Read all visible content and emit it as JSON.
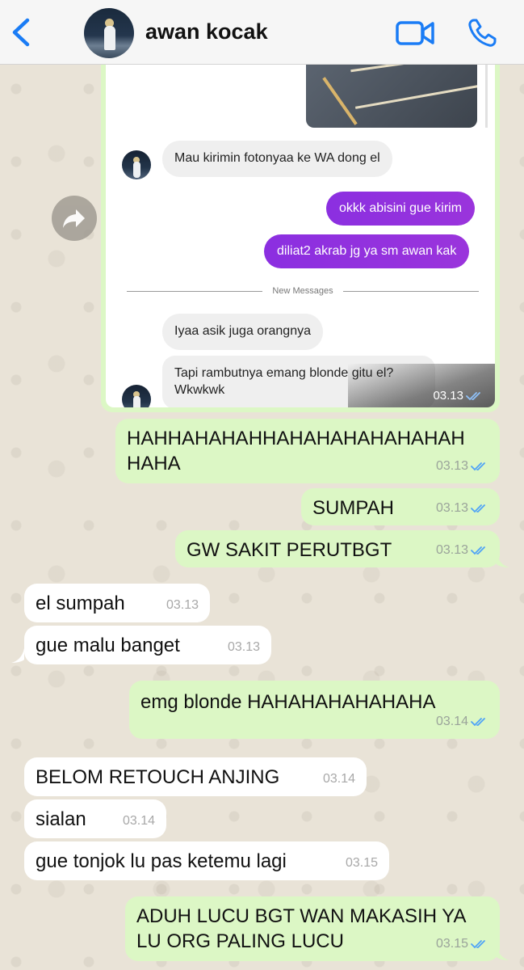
{
  "header": {
    "contact_name": "awan kocak",
    "back_icon": "chevron-left-icon",
    "video_icon": "video-camera-icon",
    "phone_icon": "phone-icon"
  },
  "screenshot": {
    "messages_in": [
      "Mau kirimin fotonyaa ke WA dong el",
      "Iyaa asik juga orangnya",
      "Tapi rambutnya emang blonde gitu el? Wkwkwk"
    ],
    "messages_out": [
      "okkk abisini gue kirim",
      "diliat2 akrab jg ya sm awan kak"
    ],
    "divider_label": "New Messages",
    "time": "03.13"
  },
  "chat": [
    {
      "dir": "out",
      "text_lines": [
        "HAHHAHAHAHHAHAHAHAHAHAHAH",
        "HAHA"
      ],
      "time": "03.13"
    },
    {
      "dir": "out",
      "text": "SUMPAH",
      "time": "03.13"
    },
    {
      "dir": "out",
      "text": "GW SAKIT PERUTBGT",
      "time": "03.13"
    },
    {
      "dir": "in",
      "text": "el sumpah",
      "time": "03.13"
    },
    {
      "dir": "in",
      "text": "gue malu banget",
      "time": "03.13"
    },
    {
      "dir": "out",
      "text": "emg blonde HAHAHAHAHAHAHA",
      "time": "03.14"
    },
    {
      "dir": "in",
      "text": "BELOM RETOUCH ANJING",
      "time": "03.14"
    },
    {
      "dir": "in",
      "text": "sialan",
      "time": "03.14"
    },
    {
      "dir": "in",
      "text": "gue tonjok lu pas ketemu lagi",
      "time": "03.15"
    },
    {
      "dir": "out",
      "text_lines": [
        "ADUH LUCU BGT WAN MAKASIH YA",
        "LU ORG PALING LUCU"
      ],
      "time": "03.15"
    }
  ],
  "colors": {
    "outgoing_bubble": "#dcf7c5",
    "incoming_bubble": "#ffffff",
    "accent_blue": "#1a7cf5",
    "ig_outgoing": "#8b2fe0"
  }
}
